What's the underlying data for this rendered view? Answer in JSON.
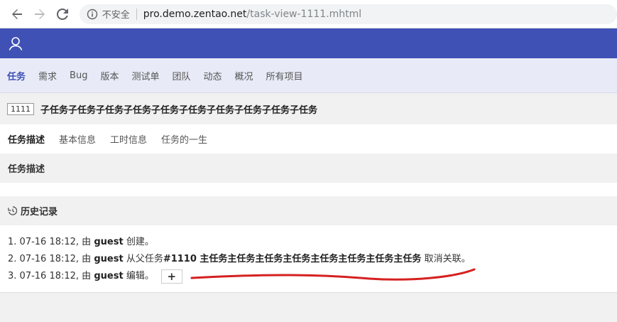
{
  "browser": {
    "security_label": "不安全",
    "url_host": "pro.demo.zentao.net",
    "url_path": "/task-view-1111.mhtml"
  },
  "nav": {
    "items": [
      {
        "label": "任务",
        "active": true
      },
      {
        "label": "需求",
        "active": false
      },
      {
        "label": "Bug",
        "active": false
      },
      {
        "label": "版本",
        "active": false
      },
      {
        "label": "测试单",
        "active": false
      },
      {
        "label": "团队",
        "active": false
      },
      {
        "label": "动态",
        "active": false
      },
      {
        "label": "概况",
        "active": false
      },
      {
        "label": "所有项目",
        "active": false
      }
    ]
  },
  "task": {
    "id": "1111",
    "title": "子任务子任务子任务子任务子任务子任务子任务子任务子任务子任务"
  },
  "tabs": [
    {
      "label": "任务描述",
      "active": true
    },
    {
      "label": "基本信息",
      "active": false
    },
    {
      "label": "工时信息",
      "active": false
    },
    {
      "label": "任务的一生",
      "active": false
    }
  ],
  "description": {
    "heading": "任务描述"
  },
  "history": {
    "heading": "历史记录",
    "items": [
      {
        "num": "1.",
        "time": "07-16 18:12, 由",
        "user": "guest",
        "action": "创建。"
      },
      {
        "num": "2.",
        "time": "07-16 18:12, 由",
        "user": "guest",
        "action_pre": "从父任务",
        "link": "#1110 主任务主任务主任务主任务主任务主任务主任务主任务",
        "action": "取消关联。"
      },
      {
        "num": "3.",
        "time": "07-16 18:12, 由",
        "user": "guest",
        "action": "编辑。",
        "expand": "+"
      }
    ]
  },
  "colors": {
    "brand": "#3f51b5",
    "annotation": "#d62020"
  }
}
